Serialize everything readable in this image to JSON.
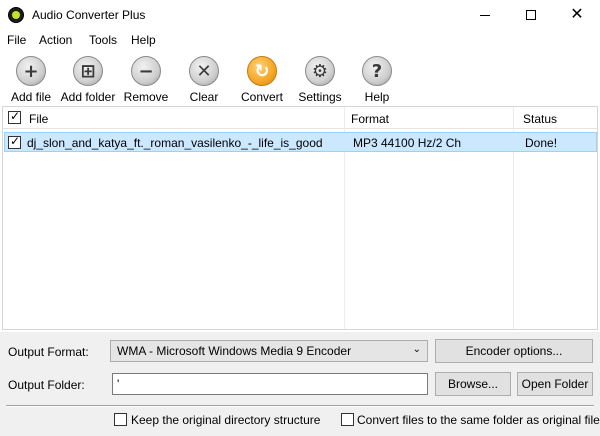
{
  "window": {
    "title": "Audio Converter Plus"
  },
  "menu": {
    "items": [
      "File",
      "Action",
      "Tools",
      "Help"
    ]
  },
  "toolbar": {
    "buttons": [
      {
        "label": "Add file",
        "icon": "plus-icon",
        "glyph": "+"
      },
      {
        "label": "Add folder",
        "icon": "add-folder-icon",
        "glyph": "⊞"
      },
      {
        "label": "Remove",
        "icon": "minus-icon",
        "glyph": "−"
      },
      {
        "label": "Clear",
        "icon": "clear-x-icon",
        "glyph": "✕"
      },
      {
        "label": "Convert",
        "icon": "convert-icon",
        "glyph": "↻"
      },
      {
        "label": "Settings",
        "icon": "gear-icon",
        "glyph": "⚙"
      },
      {
        "label": "Help",
        "icon": "help-icon",
        "glyph": "?"
      }
    ]
  },
  "list": {
    "headers": {
      "file": "File",
      "format": "Format",
      "status": "Status"
    },
    "rows": [
      {
        "checked": true,
        "file": "dj_slon_and_katya_ft._roman_vasilenko_-_life_is_good",
        "format": "MP3 44100 Hz/2 Ch",
        "status": "Done!"
      }
    ]
  },
  "output": {
    "format_label": "Output Format:",
    "format_value": "WMA - Microsoft Windows Media 9 Encoder",
    "encoder_button": "Encoder options...",
    "folder_label": "Output Folder:",
    "folder_value": "'",
    "browse_button": "Browse...",
    "open_folder_button": "Open Folder"
  },
  "options": {
    "keep_structure": "Keep the original directory structure",
    "same_folder": "Convert files to the same folder as original file"
  },
  "colors": {
    "selection": "#cce8ff",
    "selection_border": "#99d1ff",
    "convert_accent": "#f5a623"
  }
}
